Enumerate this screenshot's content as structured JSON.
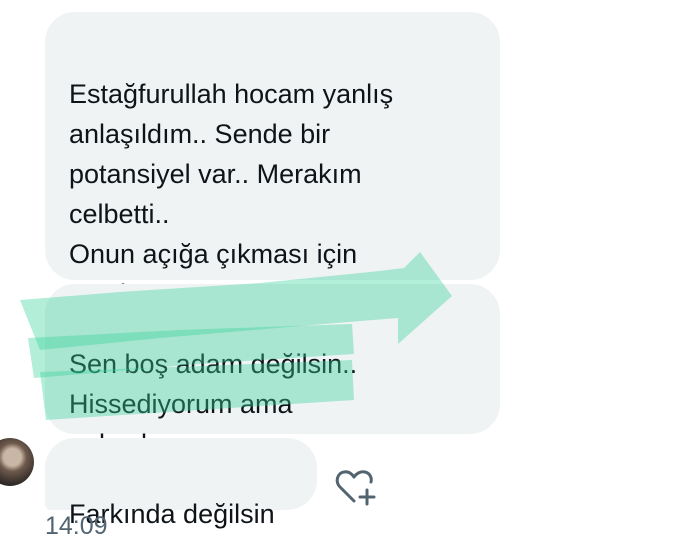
{
  "messages": [
    {
      "text": "Estağfurullah hocam yanlış\nanlaşıldım.. Sende bir\npotansiyel var.. Merakım\ncelbetti..\nOnun açığa çıkması için\nyazdım"
    },
    {
      "text": "Sen boş adam değilsin..\nHissediyorum ama\nanlaşılmıyorsun"
    },
    {
      "text": "Farkında değilsin"
    }
  ],
  "timestamp": "14:09",
  "icons": {
    "heart_add": "heart-plus-icon",
    "avatar": "avatar"
  },
  "colors": {
    "bubble": "#eff3f4",
    "text": "#0f1419",
    "timestamp": "#536471",
    "highlight": "#34d399"
  }
}
